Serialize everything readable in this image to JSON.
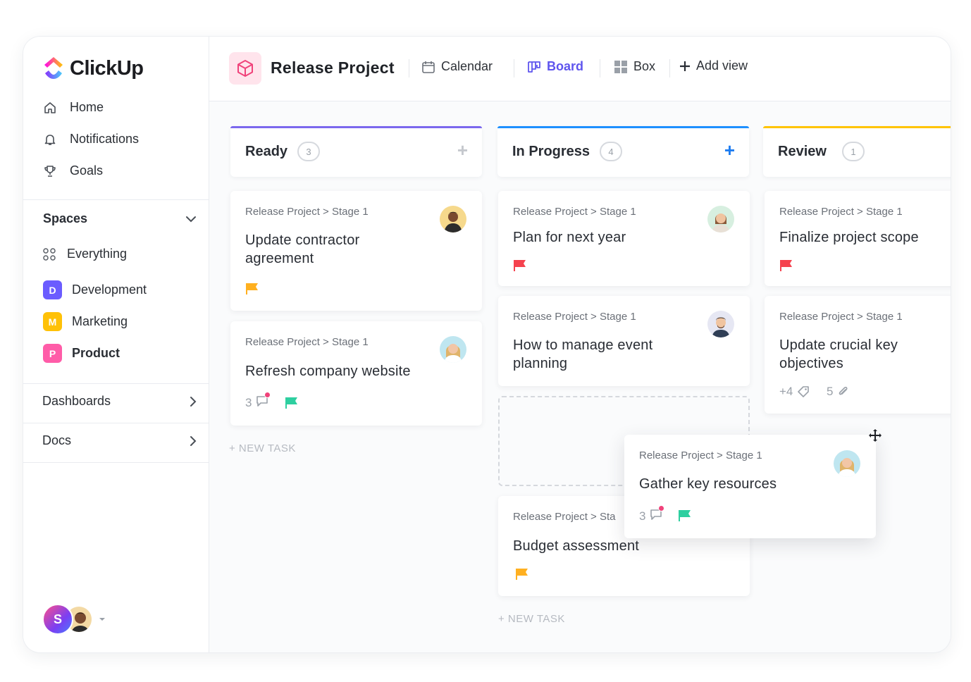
{
  "app": {
    "name": "ClickUp"
  },
  "sidebar": {
    "nav": [
      {
        "label": "Home",
        "icon": "home-icon"
      },
      {
        "label": "Notifications",
        "icon": "bell-icon"
      },
      {
        "label": "Goals",
        "icon": "trophy-icon"
      }
    ],
    "spaces_label": "Spaces",
    "spaces": [
      {
        "label": "Everything",
        "icon": "grid-dots-icon"
      },
      {
        "label": "Development",
        "badge": "D",
        "color": "#6b5cff"
      },
      {
        "label": "Marketing",
        "badge": "M",
        "color": "#ffc107"
      },
      {
        "label": "Product",
        "badge": "P",
        "color": "#ff5ca8"
      }
    ],
    "dashboards_label": "Dashboards",
    "docs_label": "Docs",
    "user_initial": "S"
  },
  "header": {
    "project_title": "Release Project",
    "views": [
      {
        "label": "Calendar",
        "icon": "calendar-icon",
        "active": false
      },
      {
        "label": "Board",
        "icon": "board-icon",
        "active": true
      },
      {
        "label": "Box",
        "icon": "box-grid-icon",
        "active": false
      }
    ],
    "add_view_label": "Add view"
  },
  "columns": [
    {
      "title": "Ready",
      "count": "3",
      "color": "#7b68ee"
    },
    {
      "title": "In Progress",
      "count": "4",
      "color": "#1e90ff"
    },
    {
      "title": "Review",
      "count": "1",
      "color": "#ffc400"
    }
  ],
  "cards": {
    "ready": [
      {
        "crumb": "Release Project > Stage 1",
        "title_lines": [
          "Update contractor",
          "agreement"
        ],
        "flag": "#ffb020"
      },
      {
        "crumb": "Release Project > Stage 1",
        "title": "Refresh company website",
        "comments": "3",
        "flag": "#2ecfa0"
      }
    ],
    "in_progress": [
      {
        "crumb": "Release Project > Stage 1",
        "title": "Plan for next year",
        "flag": "#f5424e"
      },
      {
        "crumb": "Release Project > Stage 1",
        "title_lines": [
          "How to manage event",
          "planning"
        ]
      },
      {
        "crumb": "Release Project > Sta",
        "title": "Budget assessment",
        "flag": "#ffb020"
      }
    ],
    "review": [
      {
        "crumb": "Release Project > Stage 1",
        "title": "Finalize project scope",
        "flag": "#f5424e"
      },
      {
        "crumb": "Release Project > Stage 1",
        "title_lines": [
          "Update crucial key",
          "objectives"
        ],
        "tags": "+4",
        "attachments": "5"
      }
    ],
    "dragging": {
      "crumb": "Release Project > Stage 1",
      "title": "Gather key resources",
      "comments": "3",
      "flag": "#2ecfa0"
    }
  },
  "new_task_label": "+ NEW TASK"
}
